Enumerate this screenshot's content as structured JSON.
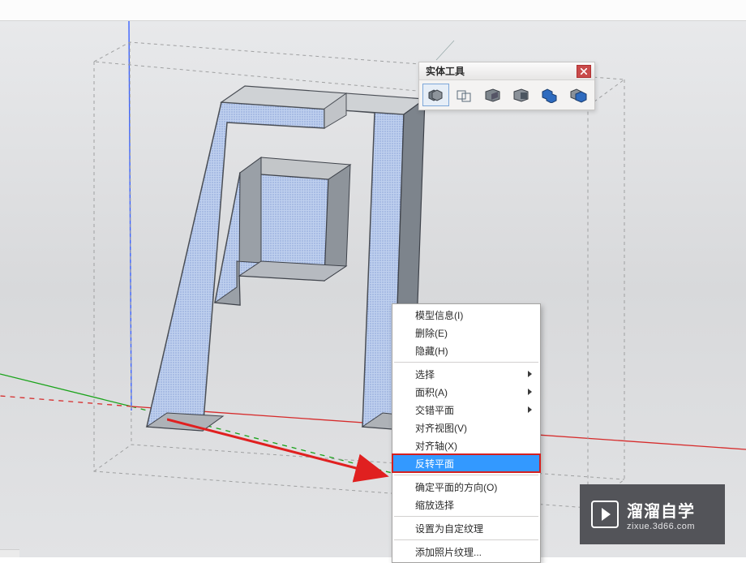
{
  "toolbar": {
    "title": "实体工具",
    "icons": [
      "solid-outer-shell",
      "solid-split",
      "solid-subtract",
      "solid-trim",
      "solid-union",
      "solid-intersect"
    ]
  },
  "context_menu": {
    "items": [
      {
        "label": "模型信息(I)",
        "sub": false
      },
      {
        "label": "删除(E)",
        "sub": false
      },
      {
        "label": "隐藏(H)",
        "sub": false
      },
      {
        "sep": true
      },
      {
        "label": "选择",
        "sub": true
      },
      {
        "label": "面积(A)",
        "sub": true
      },
      {
        "label": "交错平面",
        "sub": true
      },
      {
        "label": "对齐视图(V)",
        "sub": false
      },
      {
        "label": "对齐轴(X)",
        "sub": false
      },
      {
        "label": "反转平面",
        "sub": false,
        "highlight": true
      },
      {
        "sep": true
      },
      {
        "label": "确定平面的方向(O)",
        "sub": false
      },
      {
        "label": "缩放选择",
        "sub": false
      },
      {
        "sep": true
      },
      {
        "label": "设置为自定纹理",
        "sub": false
      },
      {
        "sep": true
      },
      {
        "label": "添加照片纹理...",
        "sub": false
      }
    ]
  },
  "watermark": {
    "brand_cn": "溜溜自学",
    "url": "zixue.3d66.com"
  }
}
